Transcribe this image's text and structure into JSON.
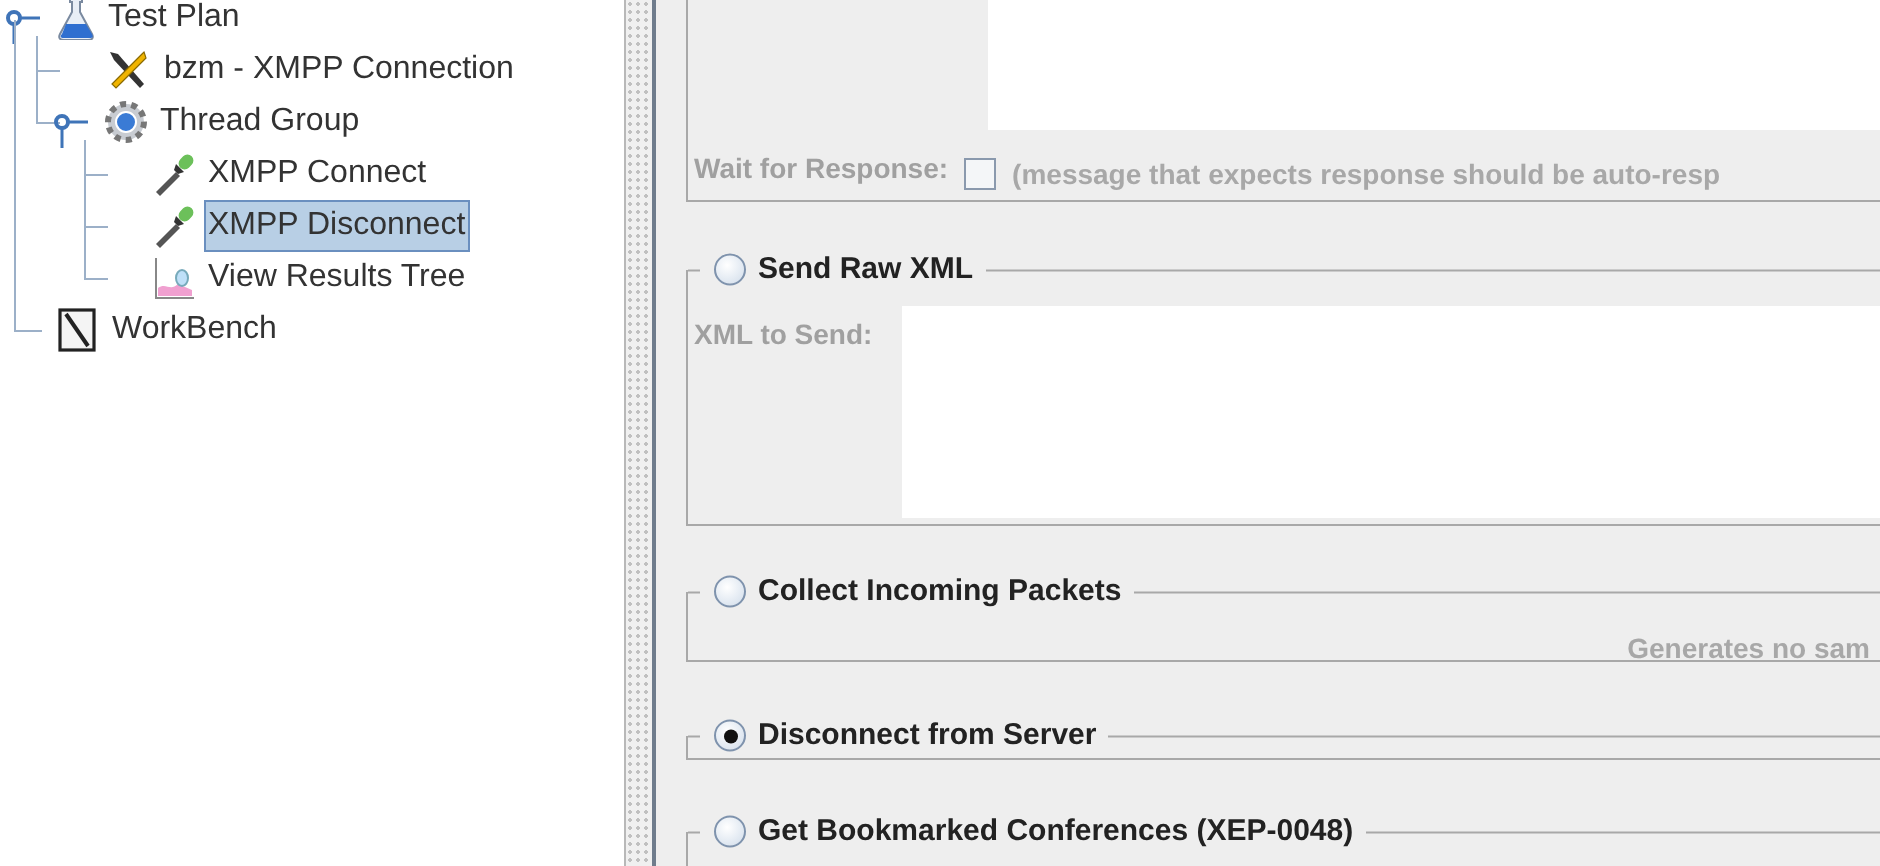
{
  "tree": [
    {
      "label": "Test Plan",
      "kind": "flask",
      "expanded": true,
      "selected": false,
      "children": [
        {
          "label": "bzm - XMPP Connection",
          "kind": "tools",
          "selected": false
        },
        {
          "label": "Thread Group",
          "kind": "gear",
          "expanded": true,
          "selected": false,
          "children": [
            {
              "label": "XMPP Connect",
              "kind": "dropper",
              "selected": false
            },
            {
              "label": "XMPP Disconnect",
              "kind": "dropper",
              "selected": true
            },
            {
              "label": "View Results Tree",
              "kind": "chart",
              "selected": false
            }
          ]
        }
      ]
    },
    {
      "label": "WorkBench",
      "kind": "notebook",
      "selected": false
    }
  ],
  "top_section": {
    "wait_label": "Wait for Response:",
    "wait_checked": false,
    "wait_note": "(message that expects response should be auto-resp"
  },
  "options": [
    {
      "kind": "xml",
      "label": "Send Raw XML",
      "selected": false,
      "field_label": "XML to Send:"
    },
    {
      "kind": "note",
      "label": "Collect Incoming Packets",
      "selected": false,
      "note": "Generates no sam"
    },
    {
      "kind": "plain",
      "label": "Disconnect from Server",
      "selected": true
    },
    {
      "kind": "open",
      "label": "Get Bookmarked Conferences (XEP-0048)",
      "selected": false
    }
  ]
}
